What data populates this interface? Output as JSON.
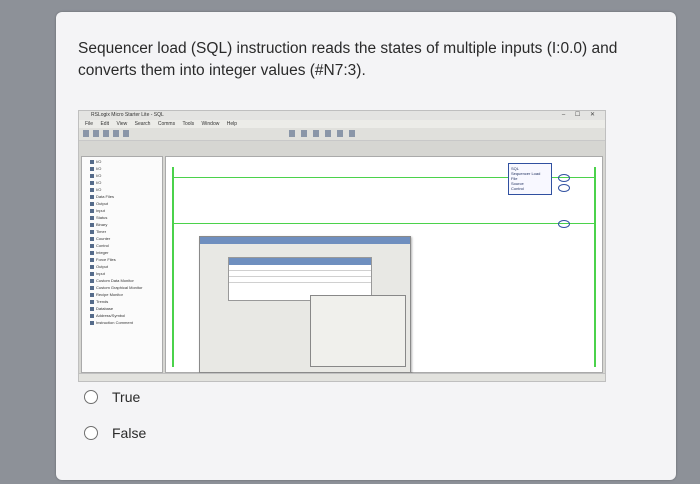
{
  "question": {
    "text": "Sequencer load (SQL) instruction reads the states of multiple inputs (I:0.0) and converts them into integer values (#N7:3)."
  },
  "options": [
    {
      "label": "True",
      "selected": false
    },
    {
      "label": "False",
      "selected": false
    }
  ],
  "screenshot": {
    "title": "RSLogix Micro Starter Lite - SQL",
    "window_controls": "– ☐ ✕",
    "menu": [
      "File",
      "Edit",
      "View",
      "Search",
      "Comms",
      "Tools",
      "Window",
      "Help"
    ],
    "tree_items": [
      "I/O",
      "I/O",
      "I/O",
      "I/O",
      "I/O",
      "Data Files",
      "Output",
      "Input",
      "Status",
      "Binary",
      "Timer",
      "Counter",
      "Control",
      "Integer",
      "Force Files",
      "Output",
      "Input",
      "Custom Data Monitor",
      "Custom Graphical Monitor",
      "Recipe Monitor",
      "Trends",
      "Database",
      "Address/Symbol",
      "Instruction Comment"
    ],
    "instruction": {
      "name": "SQL",
      "lines": [
        "Sequencer Load",
        "File",
        "Source",
        "Control",
        "Length",
        "Position"
      ]
    },
    "colors": {
      "rail": "#4bd24b",
      "instruction_border": "#3050a0",
      "window_header": "#6f8fbf"
    }
  }
}
